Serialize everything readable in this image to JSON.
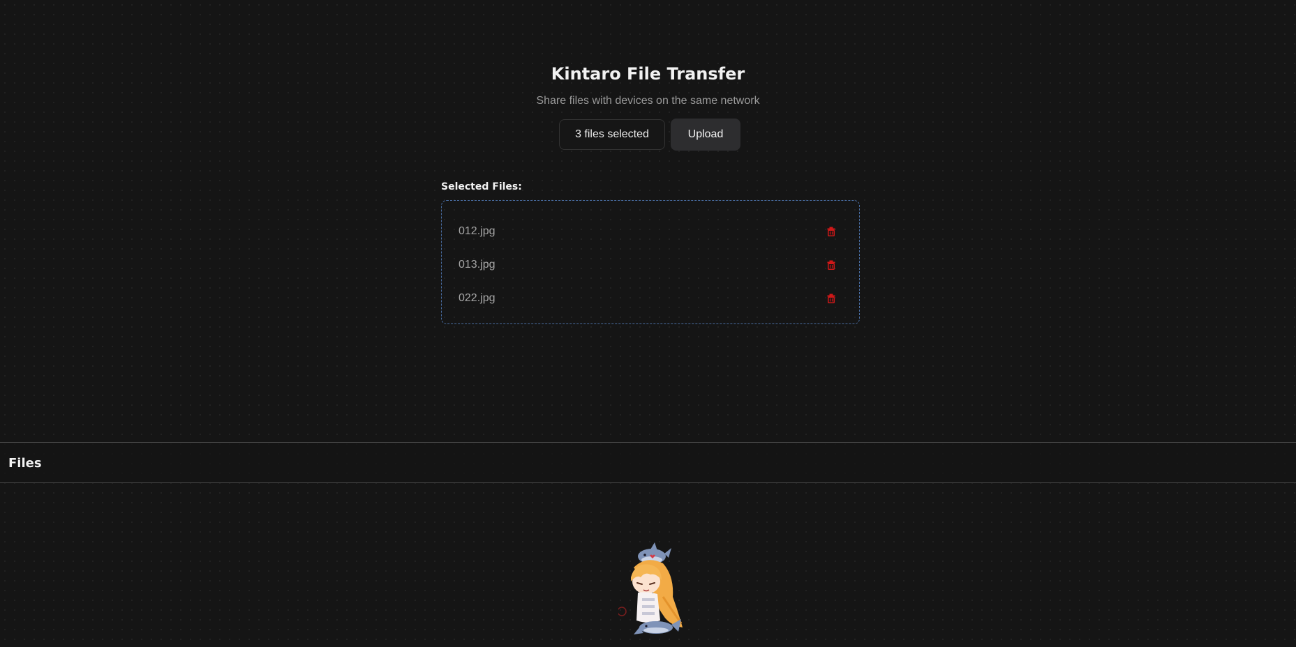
{
  "header": {
    "title": "Kintaro File Transfer",
    "subtitle": "Share files with devices on the same network"
  },
  "actions": {
    "select_label": "3 files selected",
    "upload_label": "Upload"
  },
  "selected": {
    "heading": "Selected Files:",
    "files": [
      {
        "name": "012.jpg",
        "action_icon": "trash-icon"
      },
      {
        "name": "013.jpg",
        "action_icon": "trash-icon"
      },
      {
        "name": "022.jpg",
        "action_icon": "trash-icon"
      }
    ]
  },
  "files_section": {
    "title": "Files"
  },
  "colors": {
    "background": "#151515",
    "accent_border": "#4a6fa5",
    "delete": "#d01818"
  }
}
